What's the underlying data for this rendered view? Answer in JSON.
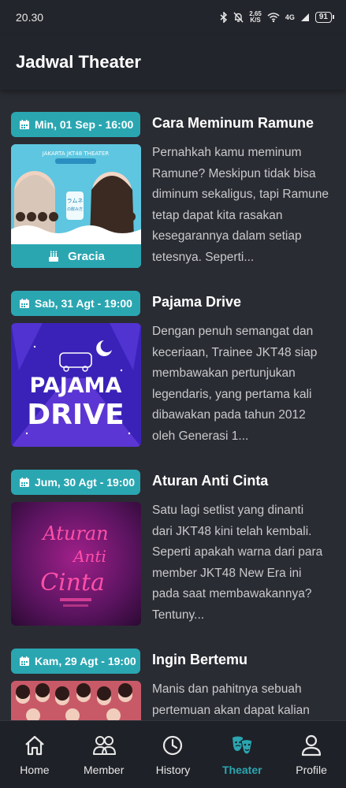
{
  "status_bar": {
    "time": "20.30",
    "net_speed_value": "2,65",
    "net_speed_unit": "K/S",
    "network": "4G",
    "battery": "91"
  },
  "header": {
    "title": "Jadwal Theater"
  },
  "shows": [
    {
      "date": "Min, 01 Sep - 16:00",
      "title": "Cara Meminum Ramune",
      "description": "Pernahkah kamu meminum\nRamune? Meskipun tidak bisa\ndiminum sekaligus, tapi Ramune\ntetap dapat kita rasakan\nkesegarannya dalam setiap\ntetesnya. Seperti...",
      "birthday_member": "Gracia",
      "thumb_caption": "JAKARTA JKT48 THEATER"
    },
    {
      "date": "Sab, 31 Agt - 19:00",
      "title": "Pajama Drive",
      "description": "Dengan penuh semangat dan\nkeceriaan, Trainee JKT48 siap\nmembawakan pertunjukan\nlegendaris, yang pertama kali\ndibawakan pada tahun 2012\noleh Generasi 1...",
      "thumb_line1": "PAJAMA",
      "thumb_line2": "DRIVE"
    },
    {
      "date": "Jum, 30 Agt - 19:00",
      "title": "Aturan Anti Cinta",
      "description": "Satu lagi setlist yang dinanti\ndari JKT48 kini telah kembali.\nSeperti apakah warna dari para\nmember JKT48 New Era ini\npada saat membawakannya?\nTentuny...",
      "thumb_line1": "Aturan",
      "thumb_line2": "Anti",
      "thumb_line3": "Cinta"
    },
    {
      "date": "Kam, 29 Agt - 19:00",
      "title": "Ingin Bertemu",
      "description": "Manis dan pahitnya sebuah\npertemuan akan dapat kalian"
    }
  ],
  "nav": [
    {
      "label": "Home",
      "icon": "home-icon"
    },
    {
      "label": "Member",
      "icon": "members-icon"
    },
    {
      "label": "History",
      "icon": "clock-icon"
    },
    {
      "label": "Theater",
      "icon": "theater-masks-icon",
      "active": true
    },
    {
      "label": "Profile",
      "icon": "user-icon"
    }
  ],
  "colors": {
    "accent": "#2aa6b1",
    "background": "#2a2c33",
    "header": "#23252c",
    "nav": "#1f2128"
  }
}
